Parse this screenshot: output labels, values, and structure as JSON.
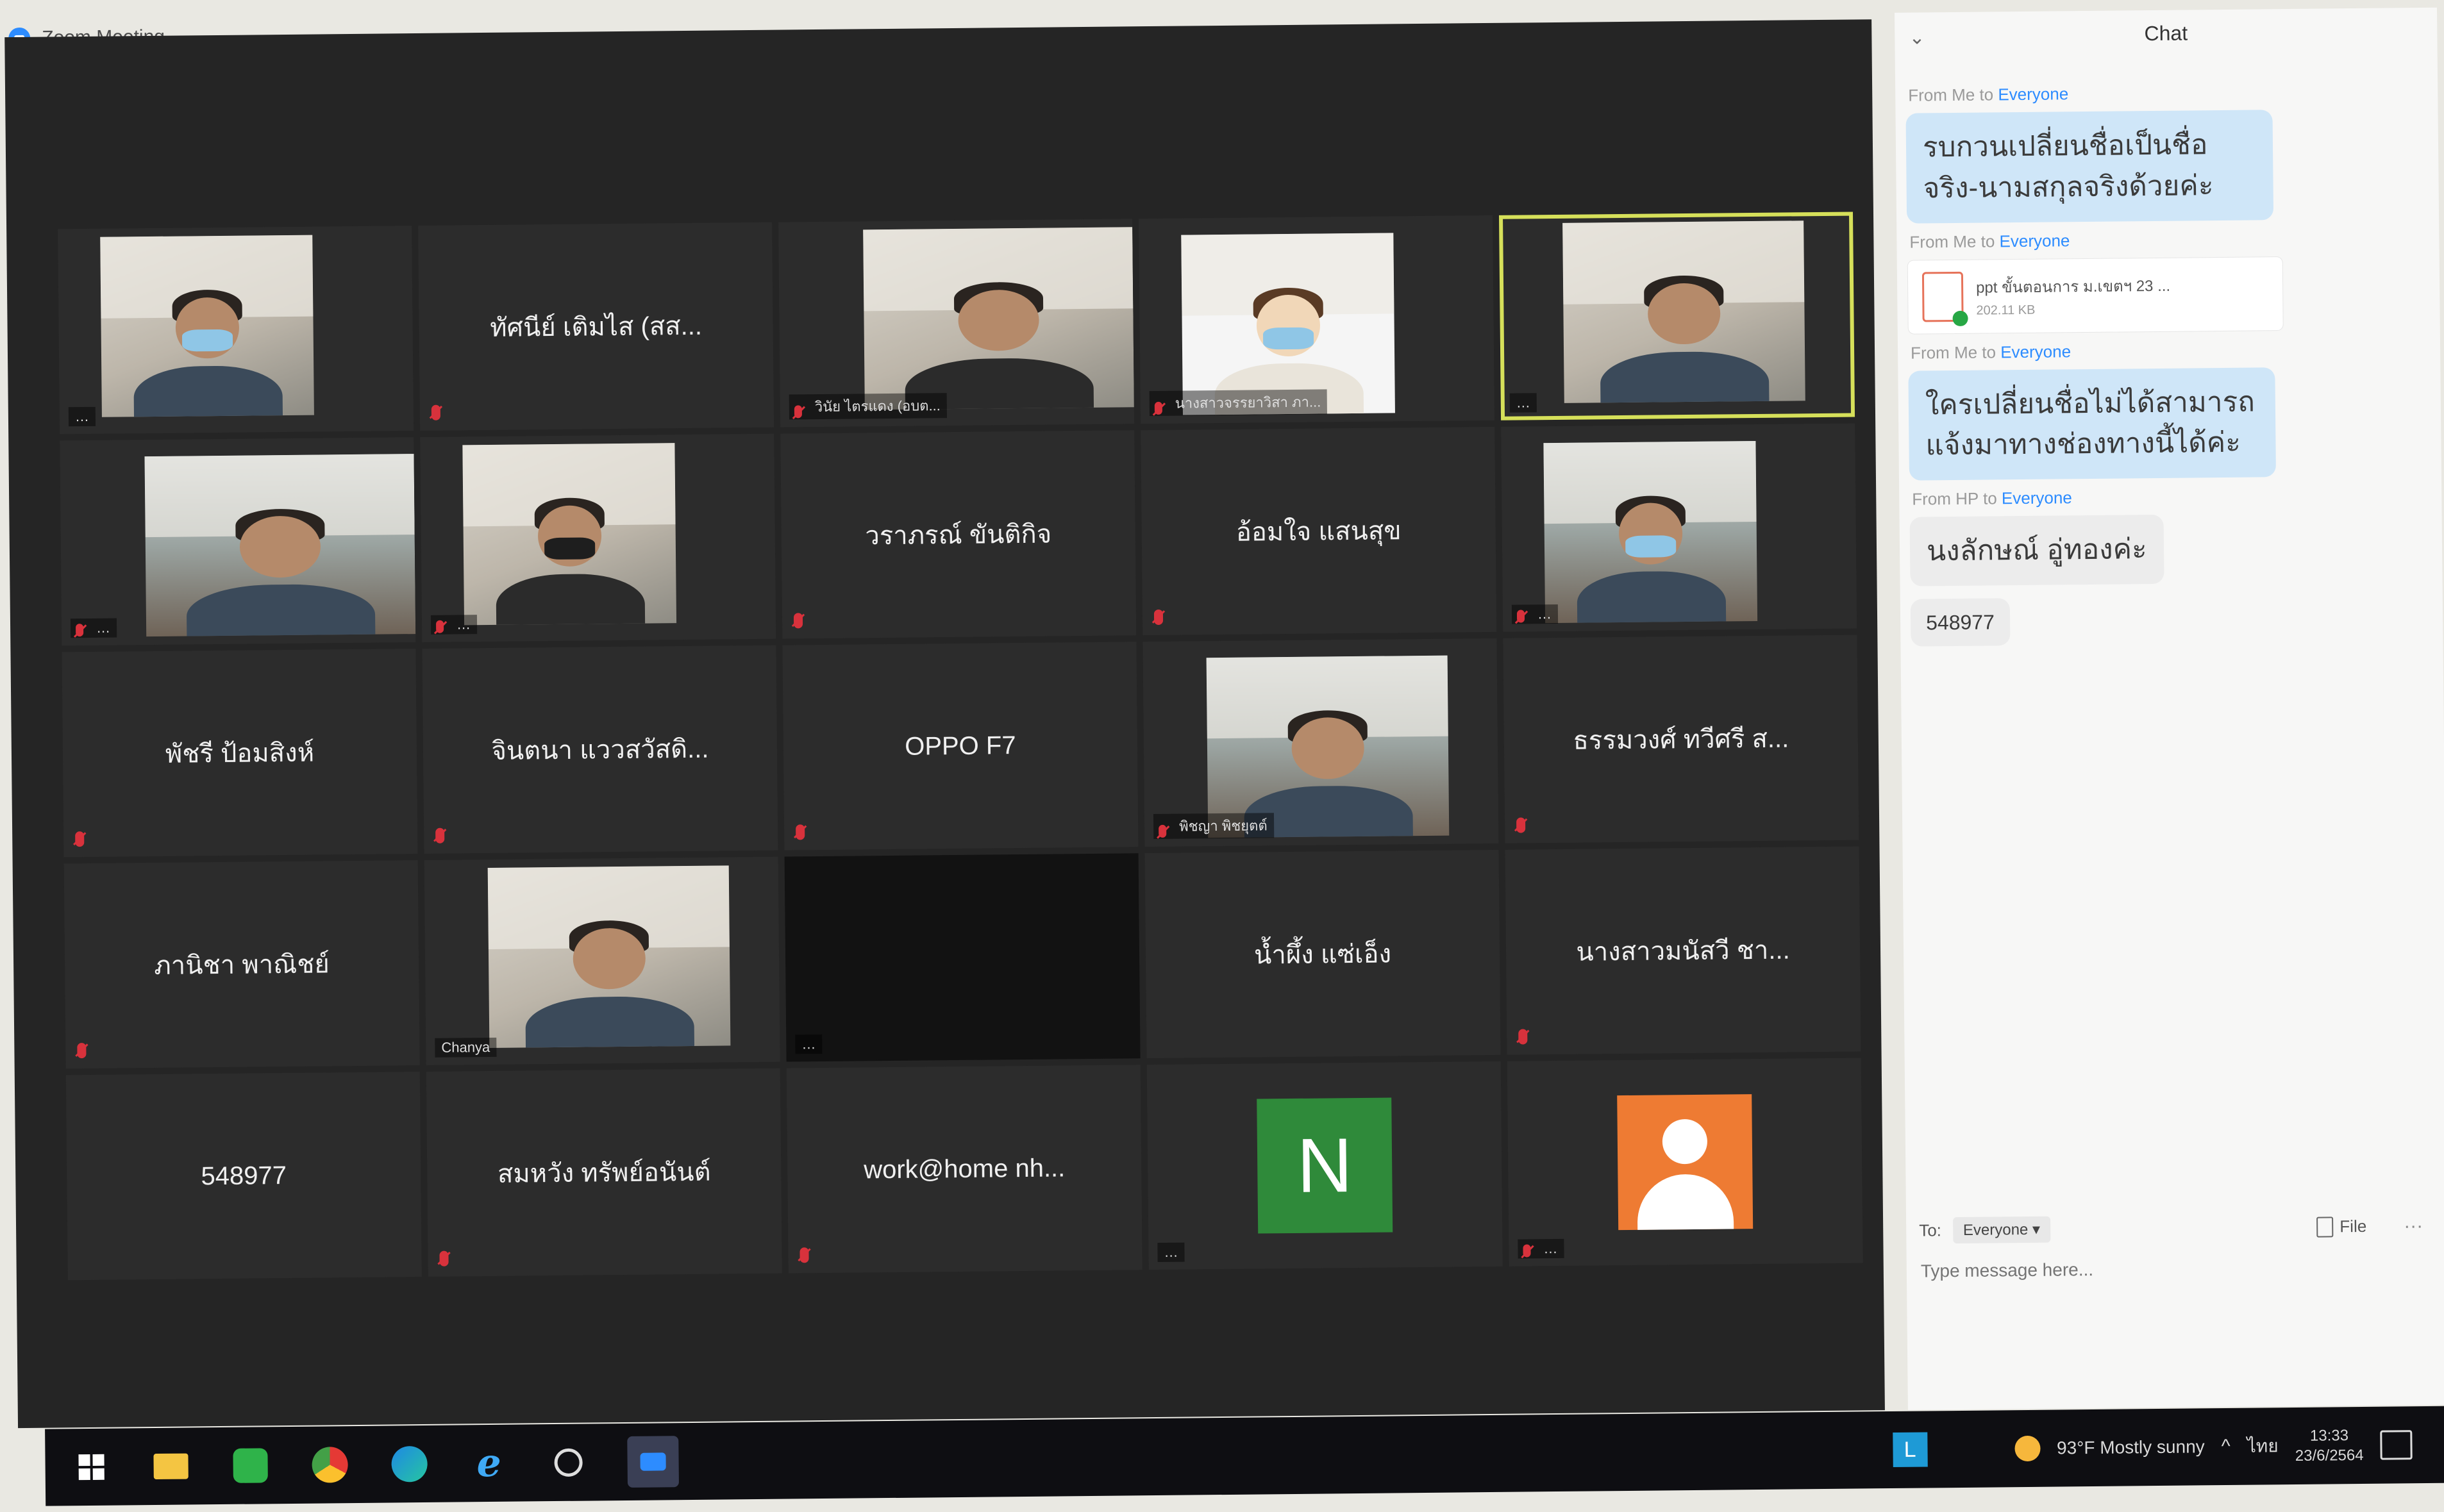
{
  "window": {
    "title": "Zoom Meeting"
  },
  "gallery": {
    "tiles": [
      {
        "name": "",
        "label": "…",
        "video": true,
        "muted": false
      },
      {
        "name": "ทัศนีย์ เติมไส (สส...",
        "label": "",
        "video": false,
        "muted": true
      },
      {
        "name": "",
        "label": "วินัย ไตรแดง (อบต...",
        "video": true,
        "muted": true
      },
      {
        "name": "",
        "label": "นางสาวจรรยาวิสา ภา...",
        "video": true,
        "muted": true
      },
      {
        "name": "",
        "label": "…",
        "video": true,
        "muted": false,
        "active": true
      },
      {
        "name": "",
        "label": "…",
        "video": true,
        "muted": true
      },
      {
        "name": "",
        "label": "…",
        "video": true,
        "muted": true
      },
      {
        "name": "วราภรณ์ ขันติกิจ",
        "label": "",
        "video": false,
        "muted": true
      },
      {
        "name": "อ้อมใจ แสนสุข",
        "label": "",
        "video": false,
        "muted": true
      },
      {
        "name": "",
        "label": "…",
        "video": true,
        "muted": true
      },
      {
        "name": "พัชรี ป้อมสิงห์",
        "label": "",
        "video": false,
        "muted": true
      },
      {
        "name": "จินตนา แววสวัสดิ...",
        "label": "",
        "video": false,
        "muted": true
      },
      {
        "name": "OPPO F7",
        "label": "",
        "video": false,
        "muted": true
      },
      {
        "name": "",
        "label": "พิชญา พิชยุตต์",
        "video": true,
        "muted": true
      },
      {
        "name": "ธรรมวงศ์ ทวีศรี ส...",
        "label": "",
        "video": false,
        "muted": true
      },
      {
        "name": "ภานิชา พาณิชย์",
        "label": "",
        "video": false,
        "muted": true
      },
      {
        "name": "",
        "label": "Chanya",
        "video": true,
        "muted": false
      },
      {
        "name": "",
        "label": "…",
        "video": false,
        "muted": false,
        "black": true
      },
      {
        "name": "น้ำผึ้ง แซ่เอ็ง",
        "label": "",
        "video": false,
        "muted": false,
        "speaking": true
      },
      {
        "name": "นางสาวมนัสวี ชา...",
        "label": "",
        "video": false,
        "muted": true
      },
      {
        "name": "548977",
        "label": "",
        "video": false,
        "muted": false
      },
      {
        "name": "สมหวัง ทรัพย์อนันต์",
        "label": "",
        "video": false,
        "muted": true
      },
      {
        "name": "work@home nh...",
        "label": "",
        "video": false,
        "muted": true
      },
      {
        "name": "",
        "label": "…",
        "video": false,
        "muted": false,
        "avatar_letter": "N"
      },
      {
        "name": "",
        "label": "…",
        "video": false,
        "muted": true,
        "avatar_person": true
      }
    ]
  },
  "chat": {
    "title": "Chat",
    "messages": [
      {
        "from": "From Me to ",
        "to": "Everyone",
        "text": "รบกวนเปลี่ยนชื่อเป็นชื่อจริง-นามสกุลจริงด้วยค่ะ",
        "style": "blue"
      },
      {
        "from": "From Me to ",
        "to": "Everyone",
        "file_name": "ppt ขั้นตอนการ ม.เขตฯ 23 ...",
        "file_size": "202.11 KB"
      },
      {
        "from": "From Me to ",
        "to": "Everyone",
        "text": "ใครเปลี่ยนชื่อไม่ได้สามารถแจ้งมาทางช่องทางนี้ได้ค่ะ",
        "style": "blue"
      },
      {
        "from": "From HP to ",
        "to": "Everyone",
        "text": "นงลักษณ์ อู่ทองค่ะ",
        "style": "grey"
      },
      {
        "text": "548977",
        "style": "grey-small"
      }
    ],
    "to_label": "To:",
    "to_value": "Everyone",
    "file_button": "File",
    "more": "···",
    "input_placeholder": "Type message here..."
  },
  "taskbar": {
    "line_tray": "L",
    "weather": "93°F  Mostly sunny",
    "language": "ไทย",
    "time": "13:33",
    "date": "23/6/2564",
    "icons": [
      "start-icon",
      "file-explorer-icon",
      "line-icon",
      "chrome-icon",
      "edge-icon",
      "internet-explorer-icon",
      "search-icon",
      "zoom-icon"
    ]
  }
}
